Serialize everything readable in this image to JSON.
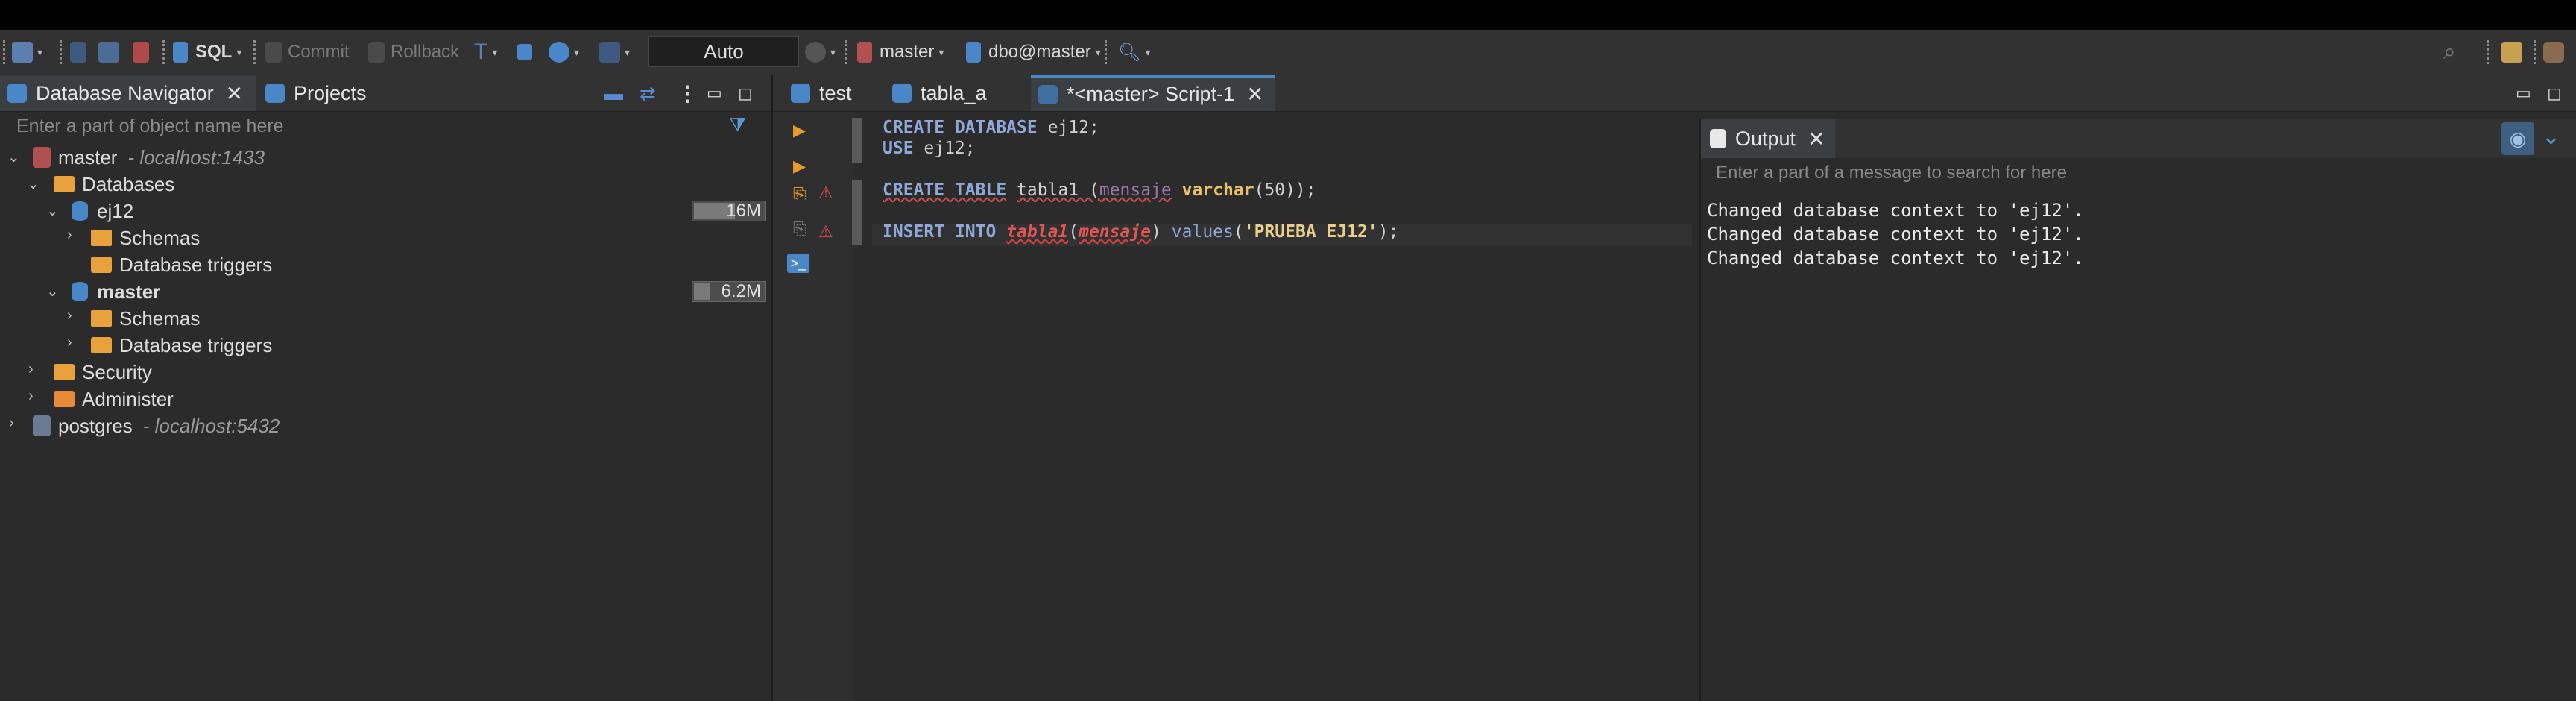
{
  "toolbar": {
    "sql": "SQL",
    "commit": "Commit",
    "rollback": "Rollback",
    "transaction_mode": "Auto",
    "datasource": "master",
    "schema": "dbo@master"
  },
  "left_panel": {
    "tabs": [
      {
        "label": "Database Navigator"
      },
      {
        "label": "Projects"
      }
    ],
    "filter_placeholder": "Enter a part of object name here",
    "tree": {
      "master_conn": {
        "label": "master",
        "host": "- localhost:1433"
      },
      "databases": "Databases",
      "ej12": {
        "label": "ej12",
        "size": "16M"
      },
      "ej12_schemas": "Schemas",
      "ej12_triggers": "Database triggers",
      "master_db": {
        "label": "master",
        "size": "6.2M"
      },
      "master_schemas": "Schemas",
      "master_triggers": "Database triggers",
      "security": "Security",
      "administer": "Administer",
      "postgres_conn": {
        "label": "postgres",
        "host": "- localhost:5432"
      }
    }
  },
  "editor": {
    "tabs": [
      {
        "label": "test"
      },
      {
        "label": "tabla_a"
      },
      {
        "label": "*<master> Script-1"
      }
    ]
  },
  "output": {
    "tab_label": "Output",
    "search_placeholder": "Enter a part of a message to search for here",
    "lines": [
      "Changed database context to 'ej12'.",
      "Changed database context to 'ej12'.",
      "Changed database context to 'ej12'."
    ]
  },
  "colors": {
    "accent_blue": "#4a87c8",
    "folder_orange": "#e9a23b",
    "error_red": "#d94c4c"
  }
}
